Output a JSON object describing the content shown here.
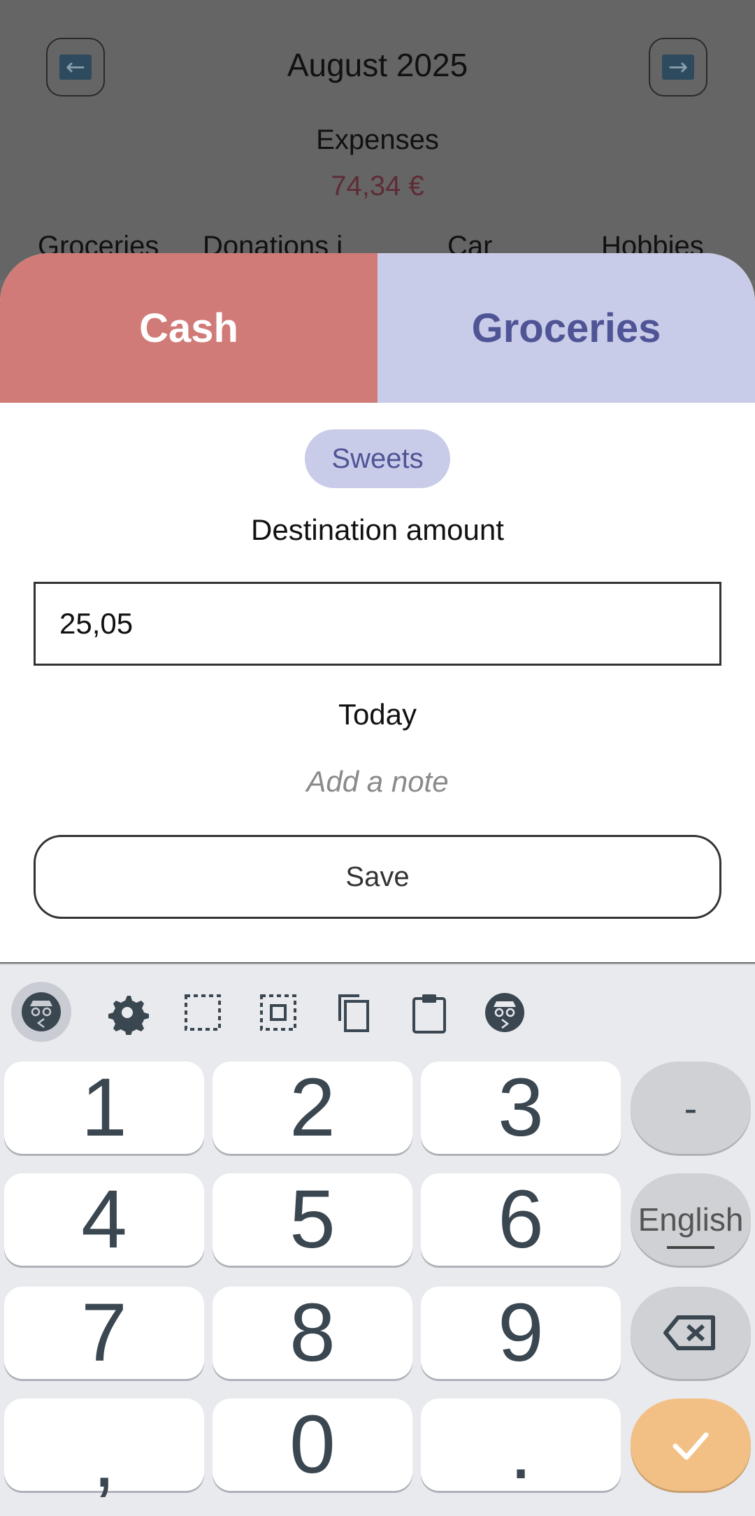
{
  "background": {
    "month_title": "August 2025",
    "prev_icon": "arrow-left-icon",
    "next_icon": "arrow-right-icon",
    "prev_glyph": "←",
    "next_glyph": "→",
    "expenses_label": "Expenses",
    "expenses_value": "74,34 €",
    "categories": [
      "Groceries",
      "Donations i",
      "Car",
      "Hobbies"
    ]
  },
  "sheet": {
    "source_label": "Cash",
    "destination_label": "Groceries",
    "source_color": "#d17b78",
    "destination_color": "#c9cce8",
    "tag_label": "Sweets",
    "destination_amount_label": "Destination amount",
    "amount_value": "25,05",
    "date_label": "Today",
    "note_placeholder": "Add a note",
    "save_label": "Save"
  },
  "keyboard": {
    "toolbar_icons": [
      "incognito-prev-icon",
      "gear-icon",
      "select-icon",
      "select-all-icon",
      "copy-icon",
      "paste-icon",
      "incognito-next-icon"
    ],
    "keys": {
      "k1": "1",
      "k2": "2",
      "k3": "3",
      "minus": "-",
      "k4": "4",
      "k5": "5",
      "k6": "6",
      "lang": "English",
      "k7": "7",
      "k8": "8",
      "k9": "9",
      "comma": ",",
      "k0": "0",
      "period": "."
    },
    "backspace_icon": "backspace-icon",
    "enter_icon": "checkmark-icon",
    "accent_color": "#f2c084"
  }
}
